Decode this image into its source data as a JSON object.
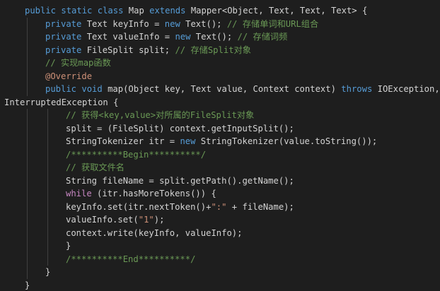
{
  "theme": {
    "background": "#1e1e1e",
    "keyword": "#569cd6",
    "control": "#c586c0",
    "string": "#ce9178",
    "comment": "#6a9955",
    "text": "#d4d4d4",
    "indent_guide": "#404040"
  },
  "lines": [
    {
      "indent": 1,
      "tokens": [
        [
          "kw",
          "public"
        ],
        [
          "plain",
          " "
        ],
        [
          "kw",
          "static"
        ],
        [
          "plain",
          " "
        ],
        [
          "kw",
          "class"
        ],
        [
          "plain",
          " Map "
        ],
        [
          "kw",
          "extends"
        ],
        [
          "plain",
          " Mapper<Object, Text, Text, Text> {"
        ]
      ]
    },
    {
      "indent": 2,
      "tokens": [
        [
          "kw",
          "private"
        ],
        [
          "plain",
          " Text keyInfo = "
        ],
        [
          "kw",
          "new"
        ],
        [
          "plain",
          " Text(); "
        ],
        [
          "com",
          "// 存储单词和URL组合"
        ]
      ]
    },
    {
      "indent": 2,
      "tokens": [
        [
          "kw",
          "private"
        ],
        [
          "plain",
          " Text valueInfo = "
        ],
        [
          "kw",
          "new"
        ],
        [
          "plain",
          " Text(); "
        ],
        [
          "com",
          "// 存储词频"
        ]
      ]
    },
    {
      "indent": 2,
      "tokens": [
        [
          "kw",
          "private"
        ],
        [
          "plain",
          " FileSplit split; "
        ],
        [
          "com",
          "// 存储Split对象"
        ]
      ]
    },
    {
      "indent": 2,
      "tokens": [
        [
          "com",
          "// 实现map函数"
        ]
      ]
    },
    {
      "indent": 2,
      "tokens": [
        [
          "ann",
          "@Override"
        ]
      ]
    },
    {
      "indent": 2,
      "tokens": [
        [
          "kw",
          "public"
        ],
        [
          "plain",
          " "
        ],
        [
          "kw",
          "void"
        ],
        [
          "plain",
          " map(Object key, Text value, Context context) "
        ],
        [
          "kw",
          "throws"
        ],
        [
          "plain",
          " IOException,"
        ]
      ]
    },
    {
      "indent": 0,
      "tokens": [
        [
          "plain",
          "InterruptedException {"
        ]
      ]
    },
    {
      "indent": 3,
      "tokens": [
        [
          "com",
          "// 获得<key,value>对所属的FileSplit对象"
        ]
      ]
    },
    {
      "indent": 3,
      "tokens": [
        [
          "plain",
          "split = (FileSplit) context.getInputSplit();"
        ]
      ]
    },
    {
      "indent": 3,
      "tokens": [
        [
          "plain",
          "StringTokenizer itr = "
        ],
        [
          "kw",
          "new"
        ],
        [
          "plain",
          " StringTokenizer(value.toString());"
        ]
      ]
    },
    {
      "indent": 3,
      "tokens": [
        [
          "com",
          "/**********Begin**********/"
        ]
      ]
    },
    {
      "indent": 3,
      "tokens": [
        [
          "com",
          "// 获取文件名"
        ]
      ]
    },
    {
      "indent": 3,
      "tokens": [
        [
          "plain",
          "String fileName = split.getPath().getName();"
        ]
      ]
    },
    {
      "indent": 3,
      "tokens": [
        [
          "ctl",
          "while"
        ],
        [
          "plain",
          " (itr.hasMoreTokens()) {"
        ]
      ]
    },
    {
      "indent": 3,
      "tokens": [
        [
          "plain",
          "keyInfo.set(itr.nextToken()+"
        ],
        [
          "str",
          "\":\""
        ],
        [
          "plain",
          " + fileName);"
        ]
      ]
    },
    {
      "indent": 3,
      "tokens": [
        [
          "plain",
          "valueInfo.set("
        ],
        [
          "str",
          "\"1\""
        ],
        [
          "plain",
          ");"
        ]
      ]
    },
    {
      "indent": 3,
      "tokens": [
        [
          "plain",
          "context.write(keyInfo, valueInfo);"
        ]
      ]
    },
    {
      "indent": 3,
      "tokens": [
        [
          "plain",
          "}"
        ]
      ]
    },
    {
      "indent": 3,
      "tokens": [
        [
          "com",
          "/**********End**********/"
        ]
      ]
    },
    {
      "indent": 2,
      "tokens": [
        [
          "plain",
          "}"
        ]
      ]
    },
    {
      "indent": 1,
      "tokens": [
        [
          "plain",
          "}"
        ]
      ]
    }
  ]
}
